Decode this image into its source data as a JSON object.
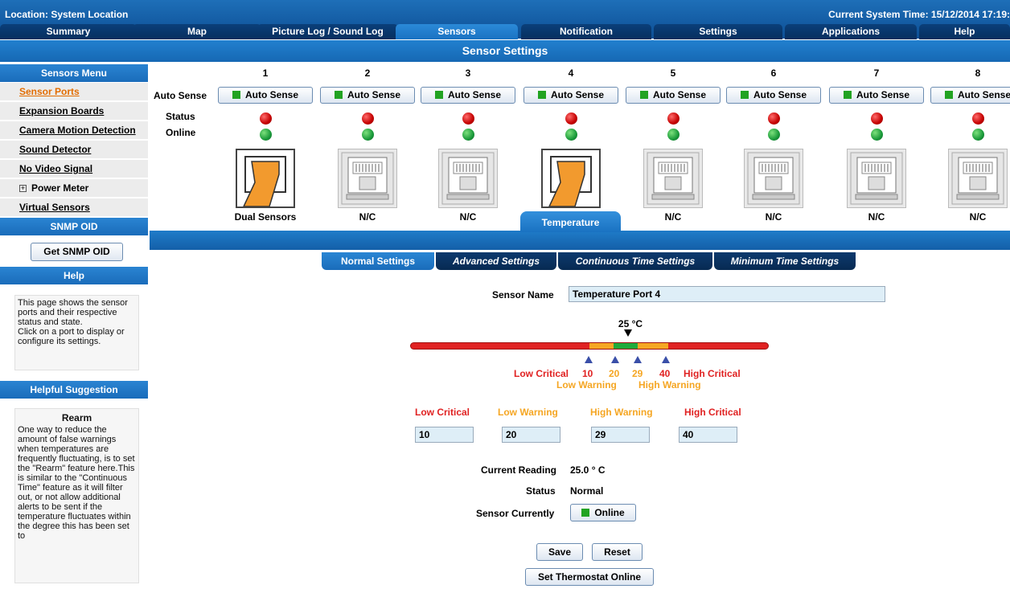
{
  "header": {
    "location": "Location: System Location",
    "system_time": "Current System Time: 15/12/2014 17:19:"
  },
  "tabs": [
    "Summary",
    "Map",
    "Picture Log / Sound Log",
    "Sensors",
    "Notification",
    "Settings",
    "Applications",
    "Help"
  ],
  "active_tab": "Sensors",
  "page_title": "Sensor Settings",
  "sidebar": {
    "menu_title": "Sensors Menu",
    "items": [
      {
        "label": "Sensor Ports",
        "active": true
      },
      {
        "label": "Expansion Boards"
      },
      {
        "label": "Camera Motion Detection"
      },
      {
        "label": "Sound Detector"
      },
      {
        "label": "No Video Signal"
      },
      {
        "label": "Power Meter",
        "expandable": true
      },
      {
        "label": "Virtual Sensors"
      }
    ],
    "snmp_title": "SNMP OID",
    "snmp_button": "Get SNMP OID",
    "help_title": "Help",
    "help_text": "This page shows the sensor ports and their respective status and state.\nClick on a port to display or configure its settings.",
    "suggestion_title": "Helpful Suggestion",
    "suggestion_heading": "Rearm",
    "suggestion_text": "One way to reduce the amount of false warnings when temperatures are frequently fluctuating, is to set the \"Rearm\" feature here.This is similar to the \"Continuous Time\" feature as it will filter out, or not allow additional alerts to be sent if the temperature fluctuates within the degree this has been set to"
  },
  "ports": {
    "row_labels": {
      "auto_sense": "Auto Sense",
      "status": "Status",
      "online": "Online"
    },
    "auto_sense_label": "Auto Sense",
    "list": [
      {
        "num": "1",
        "label": "Dual Sensors",
        "plugged": true
      },
      {
        "num": "2",
        "label": "N/C",
        "plugged": false
      },
      {
        "num": "3",
        "label": "N/C",
        "plugged": false
      },
      {
        "num": "4",
        "label": "Temperature",
        "plugged": true,
        "selected": true
      },
      {
        "num": "5",
        "label": "N/C",
        "plugged": false
      },
      {
        "num": "6",
        "label": "N/C",
        "plugged": false
      },
      {
        "num": "7",
        "label": "N/C",
        "plugged": false
      },
      {
        "num": "8",
        "label": "N/C",
        "plugged": false
      }
    ]
  },
  "settings_tabs": [
    "Normal Settings",
    "Advanced Settings",
    "Continuous Time Settings",
    "Minimum Time Settings"
  ],
  "active_settings_tab": "Normal Settings",
  "form": {
    "sensor_name_label": "Sensor Name",
    "sensor_name_value": "Temperature Port 4",
    "current_marker": "25 °C",
    "slider_labels": {
      "low_critical": "Low Critical",
      "high_critical": "High Critical",
      "low_warning": "Low Warning",
      "high_warning": "High Warning",
      "v10": "10",
      "v20": "20",
      "v29": "29",
      "v40": "40"
    },
    "threshold_labels": {
      "low_critical": "Low Critical",
      "low_warning": "Low Warning",
      "high_warning": "High Warning",
      "high_critical": "High Critical"
    },
    "threshold_values": {
      "low_critical": "10",
      "low_warning": "20",
      "high_warning": "29",
      "high_critical": "40"
    },
    "current_reading_label": "Current Reading",
    "current_reading_value": "25.0 ° C",
    "status_label": "Status",
    "status_value": "Normal",
    "sensor_currently_label": "Sensor Currently",
    "online_button": "Online",
    "save_button": "Save",
    "reset_button": "Reset",
    "thermostat_button": "Set Thermostat Online"
  },
  "colors": {
    "critical": "#e02222",
    "warning": "#f5a623",
    "normal": "#1faa3a",
    "header_blue": "#1668b4",
    "dark_tab": "#072f5e",
    "orange_link": "#e26d00"
  }
}
